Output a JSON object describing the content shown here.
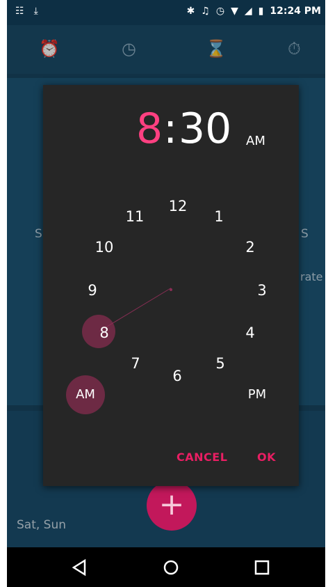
{
  "status_bar": {
    "time": "12:24 PM"
  },
  "tabs": [
    {
      "icon": "alarm-icon"
    },
    {
      "icon": "clock-icon"
    },
    {
      "icon": "hourglass-icon"
    },
    {
      "icon": "stopwatch-icon"
    }
  ],
  "background": {
    "alarm_days": "Sat, Sun",
    "vibrate_partial": "rate",
    "s_left": "S",
    "s_right": "S"
  },
  "dialog": {
    "hour": "8",
    "colon": ":",
    "minute": "30",
    "period": "AM",
    "clock_numbers": [
      "12",
      "1",
      "2",
      "3",
      "4",
      "5",
      "6",
      "7",
      "8",
      "9",
      "10",
      "11"
    ],
    "selected_hour": "8",
    "am_label": "AM",
    "pm_label": "PM",
    "cancel_label": "CANCEL",
    "ok_label": "OK"
  },
  "fab": {
    "label": "+"
  },
  "colors": {
    "accent": "#ff4081",
    "dialog_bg": "#262626",
    "app_bg": "#17435e"
  }
}
